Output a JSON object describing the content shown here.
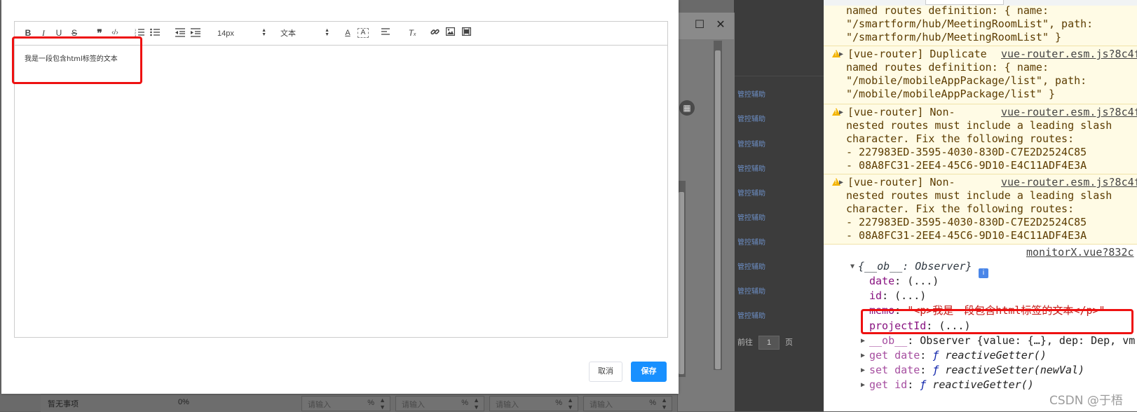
{
  "background": {
    "row_link_text": "管控辅助",
    "pager_prefix": "前往",
    "pager_value": "1",
    "pager_suffix": "页",
    "bottom_row_label": "暂无事项",
    "bottom_row_percent": "0%",
    "input_placeholder": "请输入",
    "percent_sign": "%"
  },
  "editor": {
    "font_size": "14px",
    "font_style": "文本",
    "content_text": "我是一段包含html标签的文本"
  },
  "buttons": {
    "cancel": "取消",
    "save": "保存"
  },
  "console": {
    "warn1": {
      "line1": "named routes definition: { name:",
      "line2": "\"/smartform/hub/MeetingRoomList\", path:",
      "line3": "\"/smartform/hub/MeetingRoomList\" }"
    },
    "warn2": {
      "line1": "[vue-router] Duplicate",
      "source": "vue-router.esm.js?8c4f",
      "line2": "named routes definition: { name:",
      "line3": "\"/mobile/mobileAppPackage/list\", path:",
      "line4": "\"/mobile/mobileAppPackage/list\" }"
    },
    "warn3": {
      "line1": "[vue-router] Non-",
      "source": "vue-router.esm.js?8c4f",
      "line2": "nested routes must include a leading slash",
      "line3": "character. Fix the following routes:",
      "line4": "- 227983ED-3595-4030-830D-C7E2D2524C85",
      "line5": "- 08A8FC31-2EE4-45C6-9D10-E4C11ADF4E3A"
    },
    "warn4": {
      "line1": "[vue-router] Non-",
      "source": "vue-router.esm.js?8c4f",
      "line2": "nested routes must include a leading slash",
      "line3": "character. Fix the following routes:",
      "line4": "- 227983ED-3595-4030-830D-C7E2D2524C85",
      "line5": "- 08A8FC31-2EE4-45C6-9D10-E4C11ADF4E3A"
    },
    "log_source": "monitorX.vue?832c",
    "object": {
      "header": "{__ob__: Observer}",
      "date": "(...)",
      "id": "(...)",
      "memo": "\"<p>我是一段包含html标签的文本</p>\"",
      "projectId": "(...)",
      "ob_detail": "Observer {value: {…}, dep: Dep, vm",
      "get_date": "reactiveGetter()",
      "set_date": "reactiveSetter(newVal)",
      "get_id": "reactiveGetter()"
    }
  },
  "watermark": "CSDN @于梧"
}
